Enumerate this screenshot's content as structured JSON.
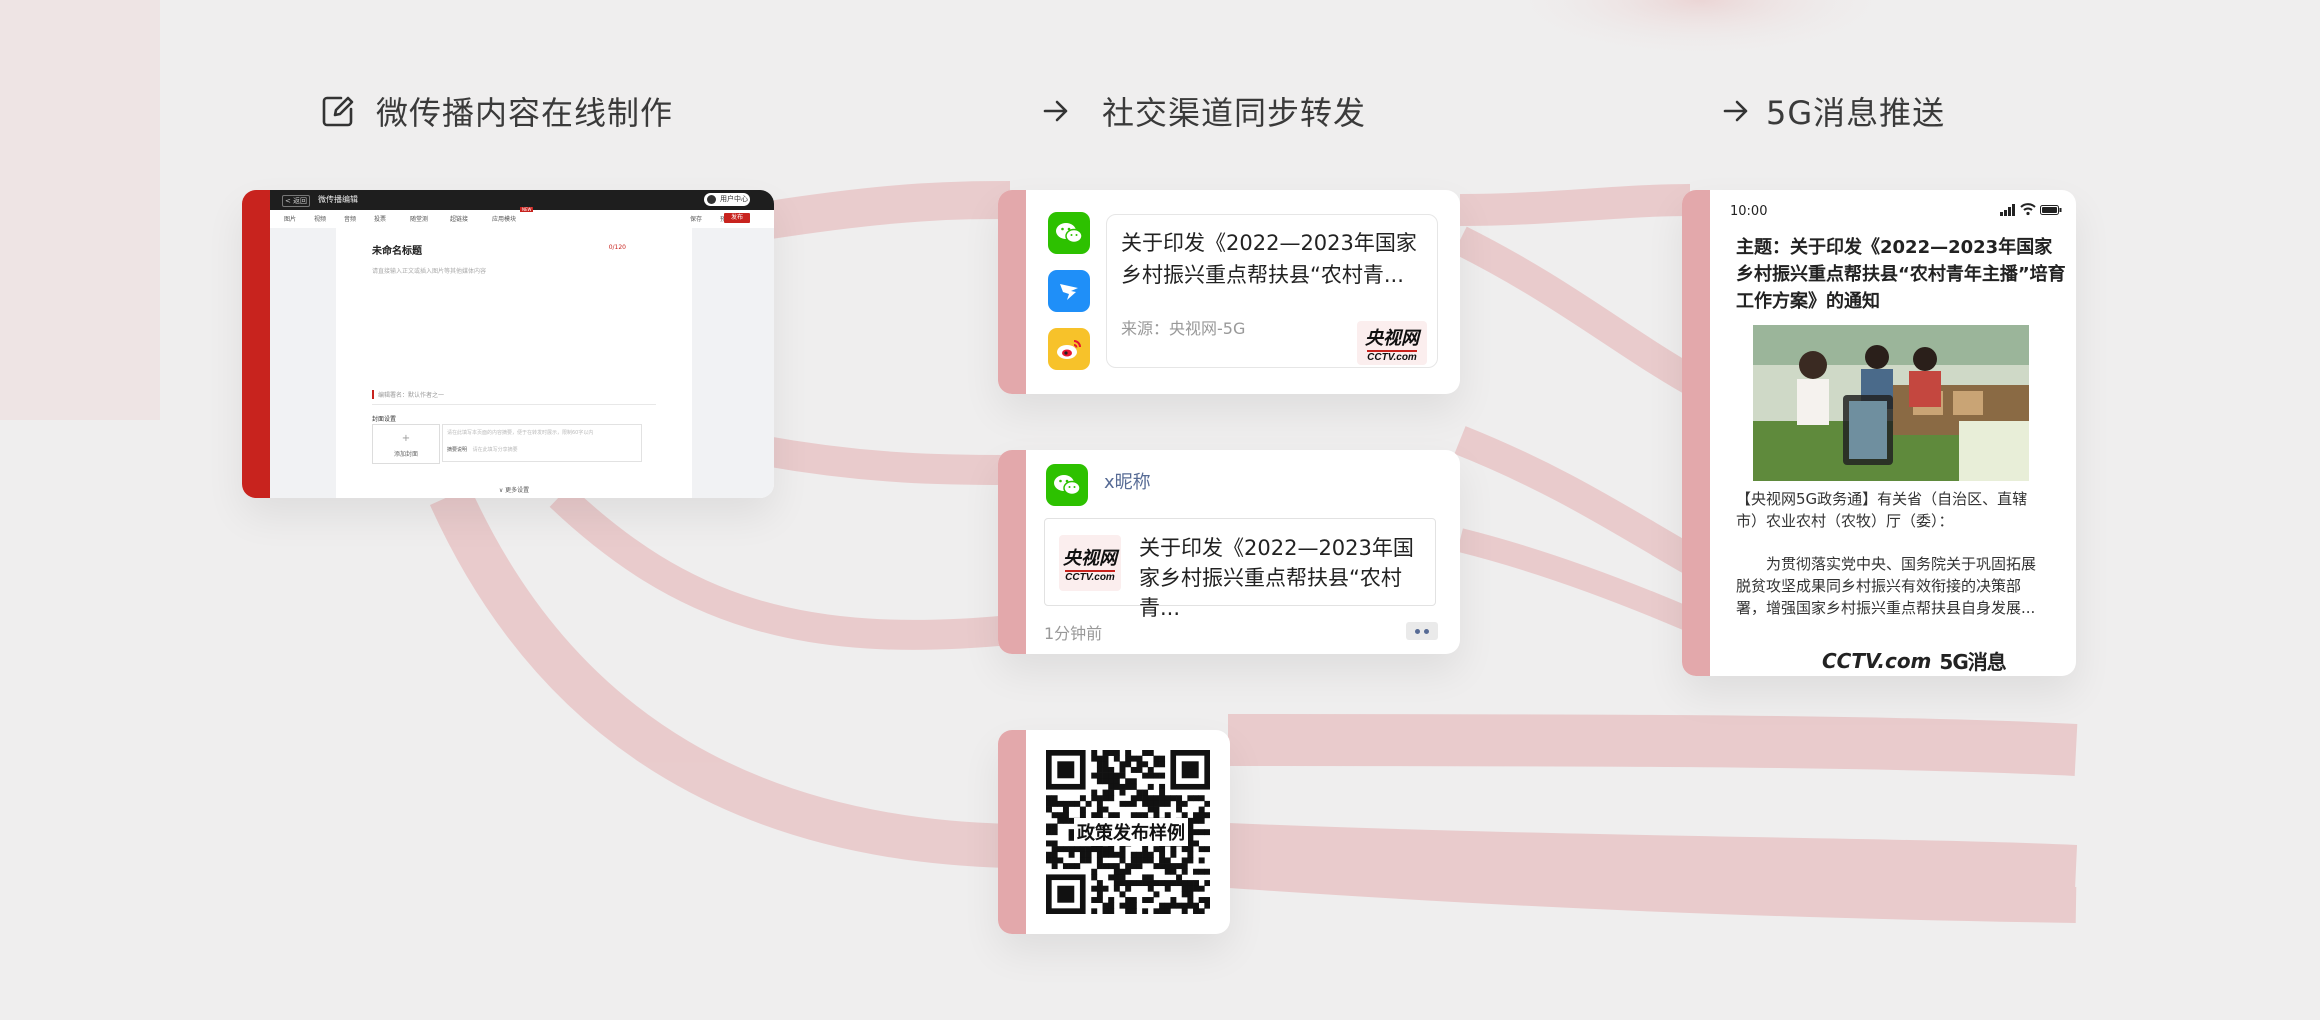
{
  "steps": [
    {
      "label": "微传播内容在线制作",
      "icon": "edit-icon"
    },
    {
      "label": "社交渠道同步转发",
      "icon": "arrow-right-icon"
    },
    {
      "label": "5G消息推送",
      "icon": "arrow-right-icon"
    }
  ],
  "colors": {
    "accent": "#c8231e",
    "tab": "#e3a8ab",
    "background": "#efeeee",
    "wechat": "#2dc100",
    "dingtalk": "#1f8ff8",
    "weibo": "#f7c22a",
    "link": "#576b95"
  },
  "editor": {
    "back": "< 返回",
    "app_title": "微传播编辑",
    "user": "用户中心",
    "tools": [
      "图片",
      "视频",
      "音频",
      "投票",
      "随堂测",
      "超链接",
      "应用模块"
    ],
    "tool_badge": "NEW",
    "save": "保存",
    "preview": "预览",
    "publish": "发布",
    "doc_title": "未命名标题",
    "char_count": "0/120",
    "placeholder": "请直接输入正文或插入图片等其他媒体内容",
    "author": "编辑署名：默认作者之一",
    "cover_label": "封面设置",
    "cover_add": "添加封面",
    "cover_plus": "+",
    "desc_placeholder": "请在此填写本页面的内容摘要，便于在转发时展示，限制60字以内",
    "desc_label": "摘要说明",
    "desc_hint": "请在此填写分享摘要",
    "more": "∨ 更多设置"
  },
  "share": {
    "title": "关于印发《2022—2023年国家乡村振兴重点帮扶县“农村青...",
    "source": "来源：央视网-5G",
    "logo_cn": "央视网",
    "logo_en": "CCTV.com"
  },
  "moments": {
    "nickname": "x昵称",
    "title": "关于印发《2022—2023年国家乡村振兴重点帮扶县“农村青...",
    "time": "1分钟前",
    "logo_cn": "央视网",
    "logo_en": "CCTV.com"
  },
  "qr": {
    "label": "政策发布样例"
  },
  "message": {
    "time": "10:00",
    "subject": "主题：关于印发《2022—2023年国家乡村振兴重点帮扶县“农村青年主播”培育工作方案》的通知",
    "body1": "【央视网5G政务通】有关省（自治区、直辖市）农业农村（农牧）厅（委）：",
    "body2": "为贯彻落实党中央、国务院关于巩固拓展脱贫攻坚成果同乡村振兴有效衔接的决策部署，增强国家乡村振兴重点帮扶县自身发展...",
    "brand_logo": "CCTV.com",
    "brand_5g": "5G消息"
  }
}
